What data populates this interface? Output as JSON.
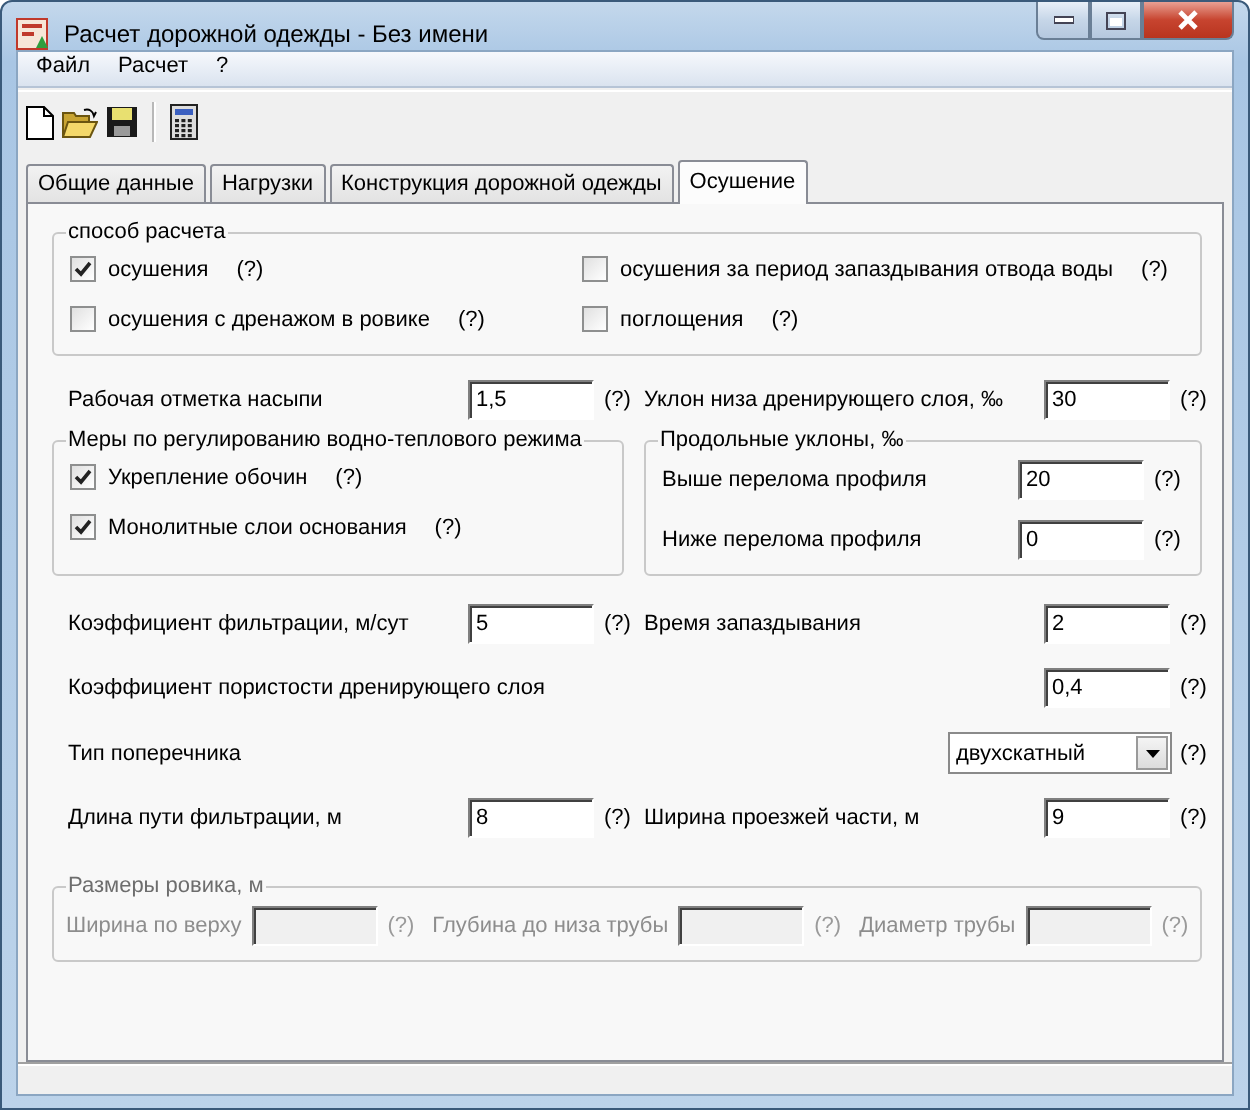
{
  "window": {
    "title": "Расчет дорожной одежды - Без имени"
  },
  "menu": [
    "Файл",
    "Расчет",
    "?"
  ],
  "tabs": [
    {
      "label": "Общие данные",
      "selected": false
    },
    {
      "label": "Нагрузки",
      "selected": false
    },
    {
      "label": "Конструкция дорожной одежды",
      "selected": false
    },
    {
      "label": "Осушение",
      "selected": true
    }
  ],
  "calc_method": {
    "title": "способ расчета",
    "options": [
      {
        "label": "осушения",
        "checked": true,
        "help": "(?)"
      },
      {
        "label": "осушения за период запаздывания отвода воды",
        "checked": false,
        "help": "(?)"
      },
      {
        "label": "осушения с дренажом в ровике",
        "checked": false,
        "help": "(?)"
      },
      {
        "label": "поглощения",
        "checked": false,
        "help": "(?)"
      }
    ]
  },
  "top_row": [
    {
      "label": "Рабочая отметка насыпи",
      "value": "1,5",
      "help": "(?)"
    },
    {
      "label": "Уклон низа дренирующего слоя, ‰",
      "value": "30",
      "help": "(?)"
    }
  ],
  "regulation": {
    "title": "Меры по регулированию водно-теплового режима",
    "options": [
      {
        "label": "Укрепление обочин",
        "checked": true,
        "help": "(?)"
      },
      {
        "label": "Монолитные слои основания",
        "checked": true,
        "help": "(?)"
      }
    ]
  },
  "slopes": {
    "title": "Продольные уклоны, ‰",
    "fields": [
      {
        "label": "Выше перелома профиля",
        "value": "20",
        "help": "(?)"
      },
      {
        "label": "Ниже перелома профиля",
        "value": "0",
        "help": "(?)"
      }
    ]
  },
  "rows": [
    {
      "kind": "pair",
      "fields": [
        {
          "label": "Коэффициент фильтрации, м/сут",
          "value": "5",
          "help": "(?)"
        },
        {
          "label": "Время запаздывания",
          "value": "2",
          "help": "(?)"
        }
      ]
    },
    {
      "kind": "wide",
      "fields": [
        {
          "label": "Коэффициент пористости дренирующего слоя",
          "value": "0,4",
          "help": "(?)"
        }
      ]
    },
    {
      "kind": "dropdown",
      "fields": [
        {
          "label": "Тип поперечника",
          "value": "двухскатный",
          "help": "(?)"
        }
      ]
    },
    {
      "kind": "pair",
      "fields": [
        {
          "label": "Длина пути фильтрации, м",
          "value": "8",
          "help": "(?)"
        },
        {
          "label": "Ширина проезжей части, м",
          "value": "9",
          "help": "(?)"
        }
      ]
    }
  ],
  "ditch": {
    "title": "Размеры ровика, м",
    "disabled": true,
    "fields": [
      {
        "label": "Ширина по верху",
        "help": "(?)"
      },
      {
        "label": "Глубина до низа трубы",
        "help": "(?)"
      },
      {
        "label": "Диаметр трубы",
        "help": "(?)"
      }
    ]
  }
}
